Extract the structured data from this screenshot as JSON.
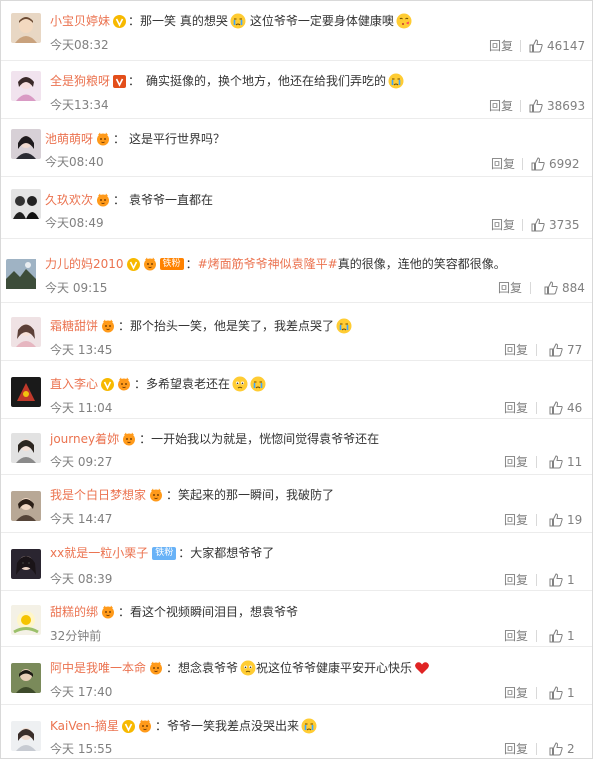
{
  "colors": {
    "username": "#eb7350",
    "meta": "#808080",
    "text": "#333333",
    "divider": "#ececec"
  },
  "comments": [
    {
      "username": "小宝贝婷妹",
      "content": "那一笑 真的想哭",
      "content2": "这位爷爷一定要身体健康噢",
      "time": "今天08:32",
      "reply": "回复",
      "likes": "46147"
    },
    {
      "username": "全是狗粮呀",
      "content": "确实挺像的，换个地方，他还在给我们弄吃的",
      "time": "今天13:34",
      "reply": "回复",
      "likes": "38693"
    },
    {
      "username": "池萌萌呀",
      "content": "这是平行世界吗？",
      "time": "今天08:40",
      "reply": "回复",
      "likes": "6992"
    },
    {
      "username": "久玖欢次",
      "content": "袁爷爷一直都在",
      "time": "今天08:49",
      "reply": "回复",
      "likes": "3735"
    },
    {
      "username": "力儿的妈2010",
      "fan_badge": "铁粉",
      "topic": "#烤面筋爷爷神似袁隆平#",
      "content": "真的很像，连他的笑容都很像。",
      "time": "今天 09:15",
      "reply": "回复",
      "likes": "884"
    },
    {
      "username": "霜糖甜饼",
      "content": "那个抬头一笑，他是笑了，我差点哭了",
      "time": "今天 13:45",
      "reply": "回复",
      "likes": "77"
    },
    {
      "username": "直入李心",
      "content": "多希望袁老还在",
      "time": "今天 11:04",
      "reply": "回复",
      "likes": "46"
    },
    {
      "username": "journey着妳",
      "content": "一开始我以为就是，恍惚间觉得袁爷爷还在",
      "time": "今天 09:27",
      "reply": "回复",
      "likes": "11"
    },
    {
      "username": "我是个白日梦想家",
      "content": "笑起来的那一瞬间，我破防了",
      "time": "今天 14:47",
      "reply": "回复",
      "likes": "19"
    },
    {
      "username": "xx就是一粒小栗子",
      "iron_badge": "铁粉",
      "content": "大家都想爷爷了",
      "time": "今天 08:39",
      "reply": "回复",
      "likes": "1"
    },
    {
      "username": "甜糕的绑",
      "content": "看这个视频瞬间泪目，想袁爷爷",
      "time": "32分钟前",
      "reply": "回复",
      "likes": "1"
    },
    {
      "username": "阿中是我唯一本命",
      "content": "想念袁爷爷",
      "content2": "祝这位爷爷健康平安开心快乐",
      "time": "今天 17:40",
      "reply": "回复",
      "likes": "1"
    },
    {
      "username": "KaiVen-摘星",
      "content": "爷爷一笑我差点没哭出来",
      "time": "今天 15:55",
      "reply": "回复",
      "likes": "2"
    }
  ]
}
